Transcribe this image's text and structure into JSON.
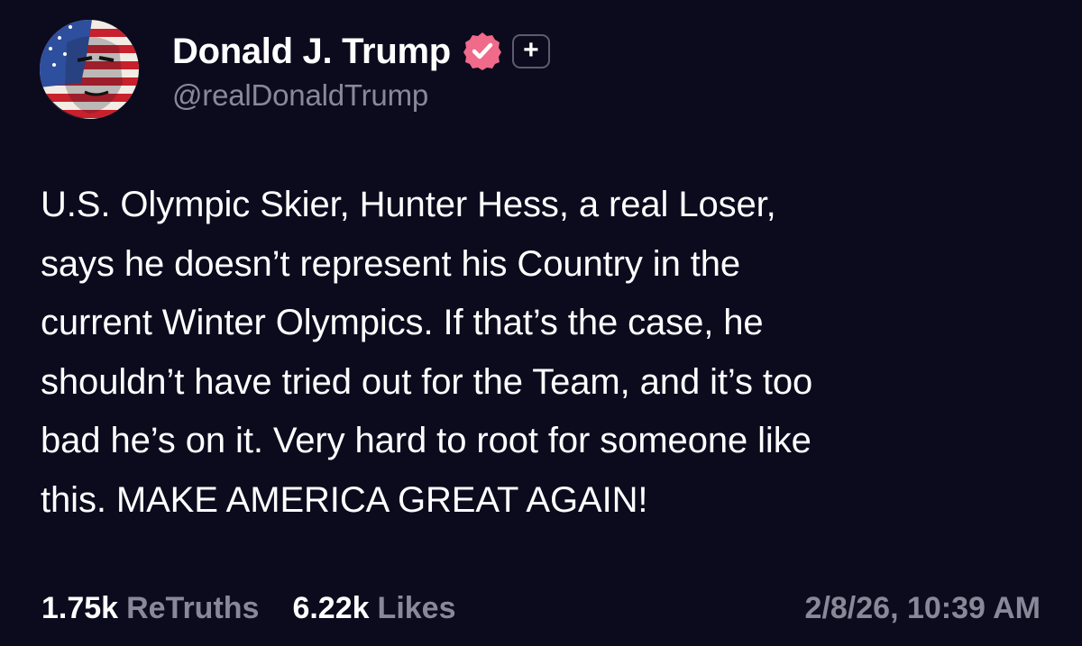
{
  "post": {
    "author": {
      "display_name": "Donald J. Trump",
      "handle": "@realDonaldTrump",
      "verified_icon": "verified-badge-icon",
      "plus_badge": "+",
      "colors": {
        "verified": "#f06a8a",
        "handle": "#8a8898"
      }
    },
    "body_lines": [
      "U.S. Olympic Skier, Hunter Hess, a real Loser,",
      "says he doesn’t represent his Country in the",
      "current Winter Olympics. If that’s the case, he",
      "shouldn’t have tried out for the Team, and it’s too",
      "bad he’s on it. Very hard to root for someone like",
      "this. MAKE AMERICA GREAT AGAIN!"
    ],
    "stats": {
      "retruths_count": "1.75k",
      "retruths_label": "ReTruths",
      "likes_count": "6.22k",
      "likes_label": "Likes"
    },
    "timestamp": "2/8/26, 10:39 AM"
  },
  "theme": {
    "background": "#0c0a1d",
    "text": "#ffffff",
    "muted": "#8a8898"
  }
}
